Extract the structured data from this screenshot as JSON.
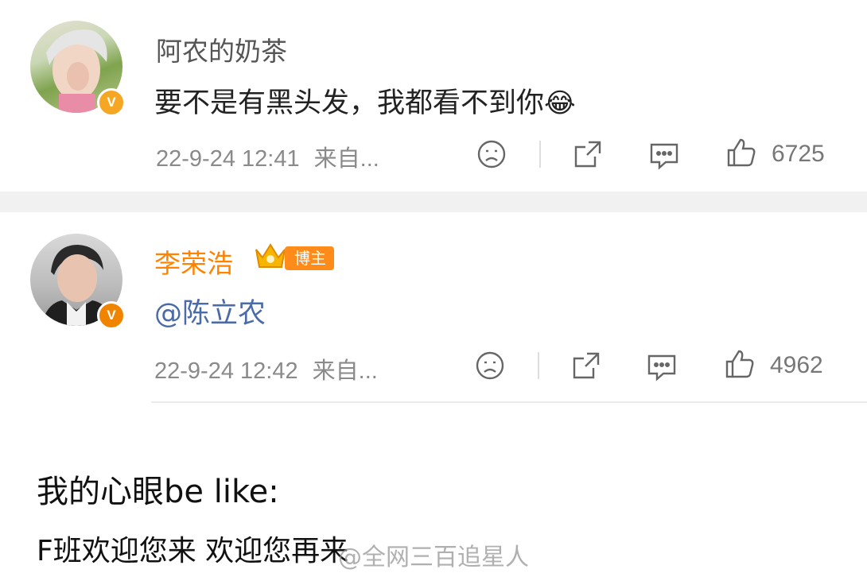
{
  "comments": [
    {
      "username": "阿农的奶茶",
      "text": "要不是有黑头发，我都看不到你",
      "emoji": "😂",
      "date": "22-9-24 12:41",
      "source": "来自...",
      "likes": "6725",
      "verified_badge": "V",
      "icons": [
        "sad-face-icon",
        "share-icon",
        "comment-icon",
        "thumbs-up-icon"
      ]
    },
    {
      "username": "李荣浩",
      "badge": "博主",
      "text": "@陈立农",
      "date": "22-9-24 12:42",
      "source": "来自...",
      "likes": "4962",
      "verified_badge": "V",
      "icons": [
        "sad-face-icon",
        "share-icon",
        "comment-icon",
        "thumbs-up-icon"
      ]
    }
  ],
  "caption": {
    "line1": "我的心眼be like:",
    "line2": "F班欢迎您来 欢迎您再来"
  },
  "watermark": "@全网三百追星人",
  "colors": {
    "orange_username": "#ff8200",
    "mention": "#4a6aa8",
    "meta_gray": "#8a8a8a"
  }
}
